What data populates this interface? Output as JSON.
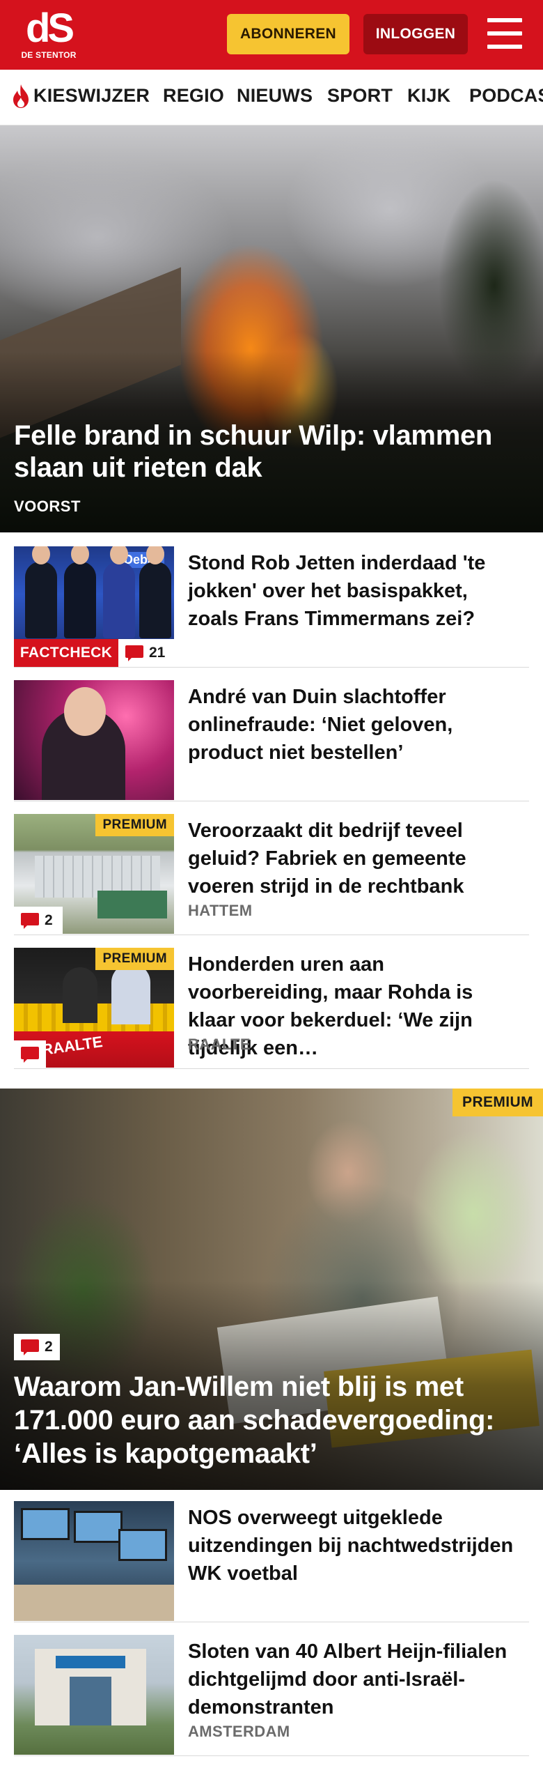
{
  "header": {
    "logo_mark": "dS",
    "logo_sub": "DE STENTOR",
    "subscribe_label": "ABONNEREN",
    "login_label": "INLOGGEN",
    "brand_color": "#d5121d"
  },
  "nav": {
    "items": [
      {
        "label": "KIESWIJZER",
        "icon": "flame-icon"
      },
      {
        "label": "REGIO"
      },
      {
        "label": "NIEUWS"
      },
      {
        "label": "SPORT"
      },
      {
        "label": "KIJK"
      },
      {
        "label": "PODCAST"
      }
    ]
  },
  "hero": {
    "title": "Felle brand in schuur Wilp: vlammen slaan uit rieten dak",
    "tag": "VOORST"
  },
  "articles": [
    {
      "title": "Stond Rob Jetten inderdaad 'te jokken' over het basispakket, zoals Frans Timmermans zei?",
      "label": "FACTCHECK",
      "comments": "21",
      "thumb_text": "Debat"
    },
    {
      "title": "André van Duin slachtoffer onlinefraude: ‘Niet geloven, product niet bestellen’"
    },
    {
      "title": "Veroorzaakt dit bedrijf teveel geluid? Fabriek en gemeente voeren strijd in de rechtbank",
      "premium": "PREMIUM",
      "comments": "2",
      "location": "HATTEM"
    },
    {
      "title": "Honderden uren aan voorbereiding, maar Rohda is klaar voor bekerduel: ‘We zijn tijdelijk een…",
      "premium": "PREMIUM",
      "location": "RAALTE",
      "thumb_text": "RAALTE"
    }
  ],
  "feature": {
    "premium": "PREMIUM",
    "comments": "2",
    "title": "Waarom Jan-Willem niet blij is met 171.000 euro aan schadevergoeding: ‘Alles is kapotgemaakt’"
  },
  "articles2": [
    {
      "title": "NOS overweegt uitgeklede uitzendingen bij nachtwedstrijden WK voetbal"
    },
    {
      "title": "Sloten van 40 Albert Heijn-filialen dichtgelijmd door anti-Israël-demonstranten",
      "location": "AMSTERDAM"
    }
  ]
}
